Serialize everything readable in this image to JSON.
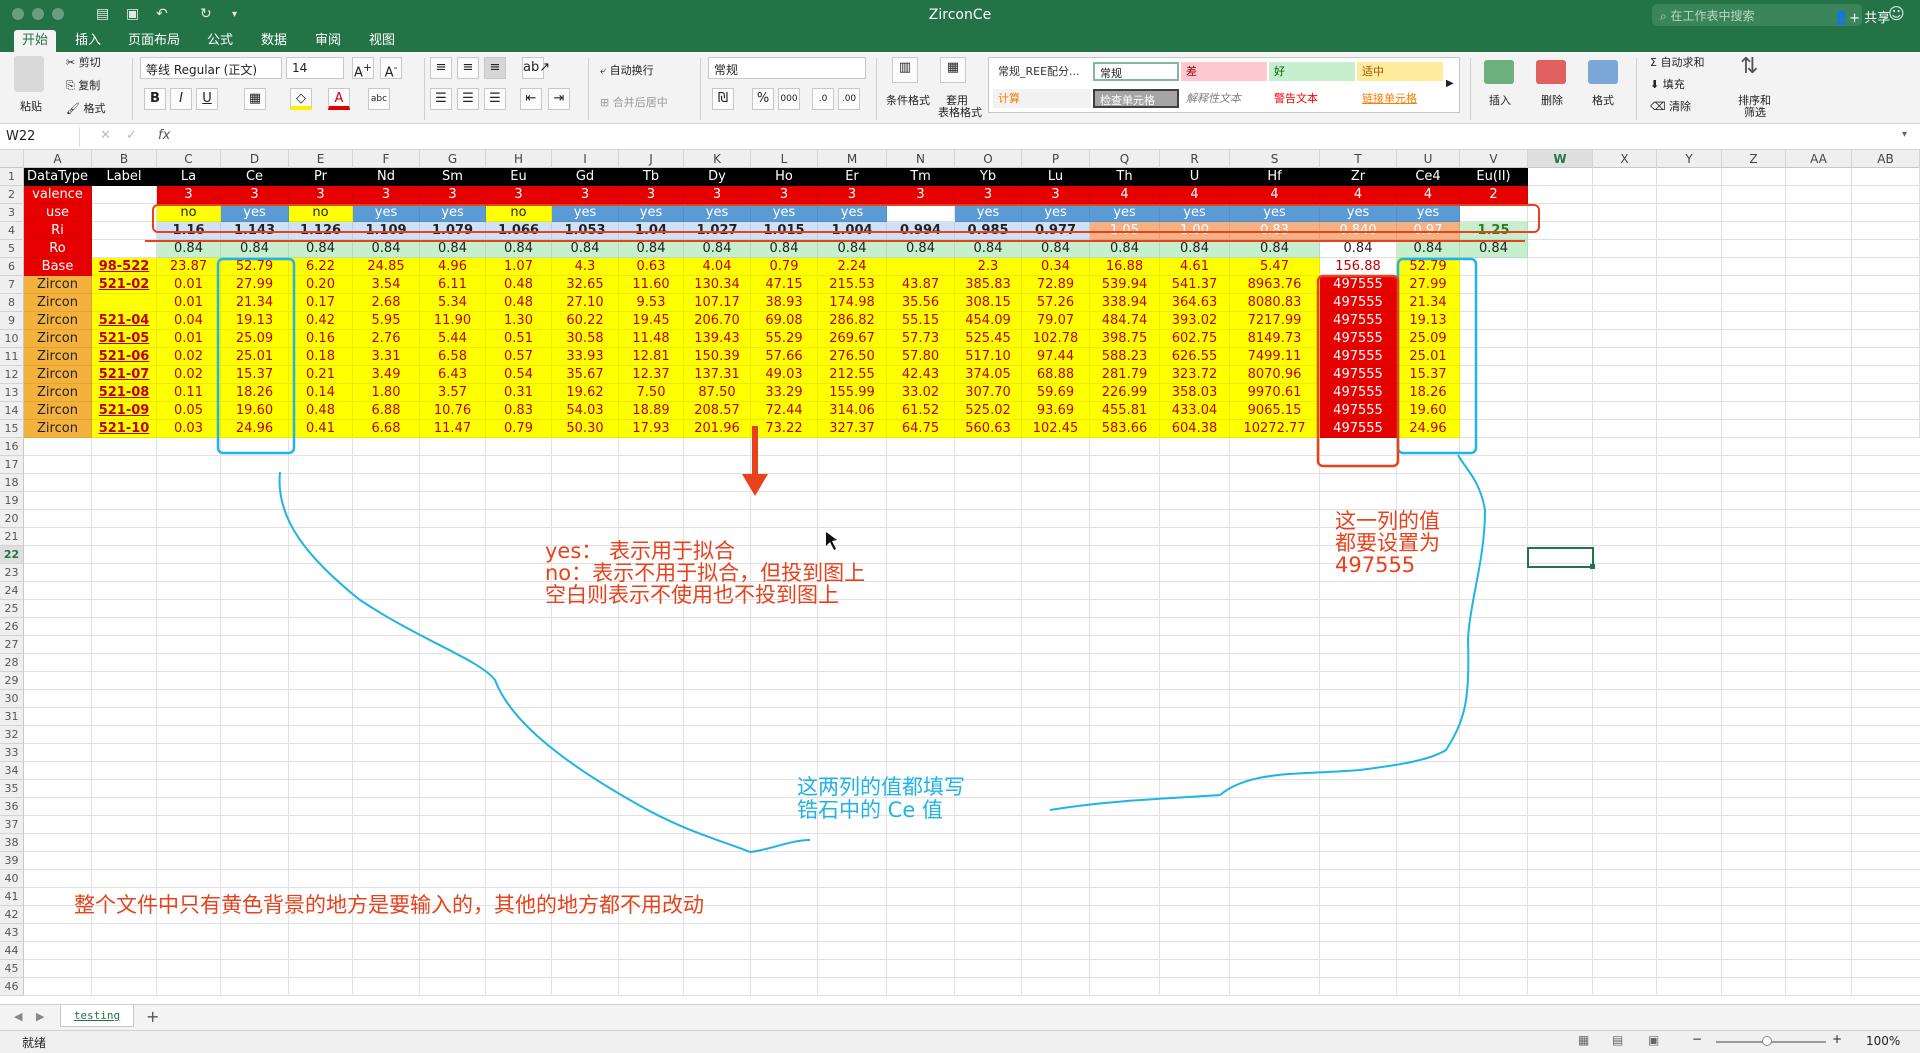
{
  "title_bar": {
    "doc_title": "ZirconCe",
    "search_placeholder": "在工作表中搜索",
    "share": "共享"
  },
  "ribbon_tabs": [
    "开始",
    "插入",
    "页面布局",
    "公式",
    "数据",
    "审阅",
    "视图"
  ],
  "ribbon": {
    "paste": "粘贴",
    "cut": "剪切",
    "copy": "复制",
    "format_painter": "格式",
    "font_name": "等线 Regular (正文)",
    "font_size": "14",
    "wrap_text": "自动换行",
    "merge_center": "合并后居中",
    "number_format": "常规",
    "cond_format": "条件格式",
    "table_format_1": "套用",
    "table_format_2": "表格格式",
    "insert": "插入",
    "delete": "删除",
    "format": "格式",
    "autosum": "自动求和",
    "fill": "填充",
    "clear": "清除",
    "sort_1": "排序和",
    "sort_2": "筛选",
    "styles": [
      {
        "label": "常规_REE配分...",
        "bg": "#ffffff",
        "color": "#333333"
      },
      {
        "label": "常规",
        "bg": "#ffffff",
        "color": "#222222"
      },
      {
        "label": "差",
        "bg": "#ffc7ce",
        "color": "#9c0006"
      },
      {
        "label": "好",
        "bg": "#c6efce",
        "color": "#006100"
      },
      {
        "label": "适中",
        "bg": "#ffeb9c",
        "color": "#9c5700"
      },
      {
        "label": "计算",
        "bg": "#f2f2f2",
        "color": "#fa7d00"
      },
      {
        "label": "检查单元格",
        "bg": "#a5a5a5",
        "color": "#ffffff"
      },
      {
        "label": "解释性文本",
        "bg": "#ffffff",
        "color": "#7f7f7f"
      },
      {
        "label": "警告文本",
        "bg": "#ffffff",
        "color": "#ff0000"
      },
      {
        "label": "链接单元格",
        "bg": "#ffffff",
        "color": "#fa7d00"
      }
    ]
  },
  "formula_bar": {
    "name_box": "W22",
    "fx": "fx",
    "value": ""
  },
  "col_letters": [
    "A",
    "B",
    "C",
    "D",
    "E",
    "F",
    "G",
    "H",
    "I",
    "J",
    "K",
    "L",
    "M",
    "N",
    "O",
    "P",
    "Q",
    "R",
    "S",
    "T",
    "U",
    "V",
    "W",
    "X",
    "Y",
    "Z",
    "AA",
    "AB"
  ],
  "rows": [
    [
      "DataType",
      "Label",
      "La",
      "Ce",
      "Pr",
      "Nd",
      "Sm",
      "Eu",
      "Gd",
      "Tb",
      "Dy",
      "Ho",
      "Er",
      "Tm",
      "Yb",
      "Lu",
      "Th",
      "U",
      "Hf",
      "Zr",
      "Ce4",
      "Eu(II)"
    ],
    [
      "valence",
      "",
      "3",
      "3",
      "3",
      "3",
      "3",
      "3",
      "3",
      "3",
      "3",
      "3",
      "3",
      "3",
      "3",
      "3",
      "4",
      "4",
      "4",
      "4",
      "4",
      "2"
    ],
    [
      "use",
      "",
      "no",
      "yes",
      "no",
      "yes",
      "yes",
      "no",
      "yes",
      "yes",
      "yes",
      "yes",
      "yes",
      "",
      "yes",
      "yes",
      "yes",
      "yes",
      "yes",
      "yes",
      "yes",
      ""
    ],
    [
      "Ri",
      "",
      "1.16",
      "1.143",
      "1.126",
      "1.109",
      "1.079",
      "1.066",
      "1.053",
      "1.04",
      "1.027",
      "1.015",
      "1.004",
      "0.994",
      "0.985",
      "0.977",
      "1.05",
      "1.00",
      "0.83",
      "0.840",
      "0.97",
      "1.25"
    ],
    [
      "Ro",
      "",
      "0.84",
      "0.84",
      "0.84",
      "0.84",
      "0.84",
      "0.84",
      "0.84",
      "0.84",
      "0.84",
      "0.84",
      "0.84",
      "0.84",
      "0.84",
      "0.84",
      "0.84",
      "0.84",
      "0.84",
      "0.84",
      "0.84",
      "0.84"
    ],
    [
      "Base",
      "98-522",
      "23.87",
      "52.79",
      "6.22",
      "24.85",
      "4.96",
      "1.07",
      "4.3",
      "0.63",
      "4.04",
      "0.79",
      "2.24",
      "",
      "2.3",
      "0.34",
      "16.88",
      "4.61",
      "5.47",
      "156.88",
      "52.79",
      ""
    ],
    [
      "Zircon",
      "521-02",
      "0.01",
      "27.99",
      "0.20",
      "3.54",
      "6.11",
      "0.48",
      "32.65",
      "11.60",
      "130.34",
      "47.15",
      "215.53",
      "43.87",
      "385.83",
      "72.89",
      "539.94",
      "541.37",
      "8963.76",
      "497555",
      "27.99",
      ""
    ],
    [
      "Zircon",
      "",
      "0.01",
      "21.34",
      "0.17",
      "2.68",
      "5.34",
      "0.48",
      "27.10",
      "9.53",
      "107.17",
      "38.93",
      "174.98",
      "35.56",
      "308.15",
      "57.26",
      "338.94",
      "364.63",
      "8080.83",
      "497555",
      "21.34",
      ""
    ],
    [
      "Zircon",
      "521-04",
      "0.04",
      "19.13",
      "0.42",
      "5.95",
      "11.90",
      "1.30",
      "60.22",
      "19.45",
      "206.70",
      "69.08",
      "286.82",
      "55.15",
      "454.09",
      "79.07",
      "484.74",
      "393.02",
      "7217.99",
      "497555",
      "19.13",
      ""
    ],
    [
      "Zircon",
      "521-05",
      "0.01",
      "25.09",
      "0.16",
      "2.76",
      "5.44",
      "0.51",
      "30.58",
      "11.48",
      "139.43",
      "55.29",
      "269.67",
      "57.73",
      "525.45",
      "102.78",
      "398.75",
      "602.75",
      "8149.73",
      "497555",
      "25.09",
      ""
    ],
    [
      "Zircon",
      "521-06",
      "0.02",
      "25.01",
      "0.18",
      "3.31",
      "6.58",
      "0.57",
      "33.93",
      "12.81",
      "150.39",
      "57.66",
      "276.50",
      "57.80",
      "517.10",
      "97.44",
      "588.23",
      "626.55",
      "7499.11",
      "497555",
      "25.01",
      ""
    ],
    [
      "Zircon",
      "521-07",
      "0.02",
      "15.37",
      "0.21",
      "3.49",
      "6.43",
      "0.54",
      "35.67",
      "12.37",
      "137.31",
      "49.03",
      "212.55",
      "42.43",
      "374.05",
      "68.88",
      "281.79",
      "323.72",
      "8070.96",
      "497555",
      "15.37",
      ""
    ],
    [
      "Zircon",
      "521-08",
      "0.11",
      "18.26",
      "0.14",
      "1.80",
      "3.57",
      "0.31",
      "19.62",
      "7.50",
      "87.50",
      "33.29",
      "155.99",
      "33.02",
      "307.70",
      "59.69",
      "226.99",
      "358.03",
      "9970.61",
      "497555",
      "18.26",
      ""
    ],
    [
      "Zircon",
      "521-09",
      "0.05",
      "19.60",
      "0.48",
      "6.88",
      "10.76",
      "0.83",
      "54.03",
      "18.89",
      "208.57",
      "72.44",
      "314.06",
      "61.52",
      "525.02",
      "93.69",
      "455.81",
      "433.04",
      "9065.15",
      "497555",
      "19.60",
      ""
    ],
    [
      "Zircon",
      "521-10",
      "0.03",
      "24.96",
      "0.41",
      "6.68",
      "11.47",
      "0.79",
      "50.30",
      "17.93",
      "201.96",
      "73.22",
      "327.37",
      "64.75",
      "560.63",
      "102.45",
      "583.66",
      "604.38",
      "10272.77",
      "497555",
      "24.96",
      ""
    ]
  ],
  "annotations": {
    "yes_no_1": "yes： 表示用于拟合",
    "yes_no_2": "no：表示不用于拟合，但投到图上",
    "yes_no_3": "空白则表示不使用也不投到图上",
    "zr_1": "这一列的值",
    "zr_2": "都要设置为",
    "zr_3": "497555",
    "ce_1": "这两列的值都填写",
    "ce_2": "锆石中的 Ce 值",
    "bottom": "整个文件中只有黄色背景的地方是要输入的，其他的地方都不用改动"
  },
  "sheet_tab": "testing",
  "status": {
    "ready": "就绪",
    "zoom": "100%"
  }
}
